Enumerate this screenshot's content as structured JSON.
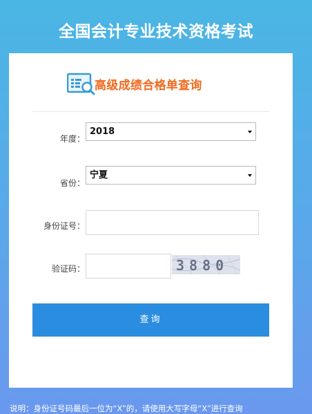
{
  "header": {
    "title": "全国会计专业技术资格考试"
  },
  "panel": {
    "icon": "search-document-icon",
    "title": "高级成绩合格单查询"
  },
  "form": {
    "year_label": "年度：",
    "year_value": "2018",
    "province_label": "省份：",
    "province_value": "宁夏",
    "id_label": "身份证号：",
    "id_value": "",
    "captcha_label": "验证码：",
    "captcha_value": "",
    "captcha_image_text": "3880",
    "submit_label": "查询"
  },
  "footer": {
    "note": "说明：身份证号码最后一位为“X”的，请使用大写字母“X”进行查询"
  },
  "colors": {
    "accent": "#2b8de0",
    "title_orange": "#f06a1e",
    "background_top": "#4ab6e4",
    "background_bottom": "#6a98ee"
  }
}
